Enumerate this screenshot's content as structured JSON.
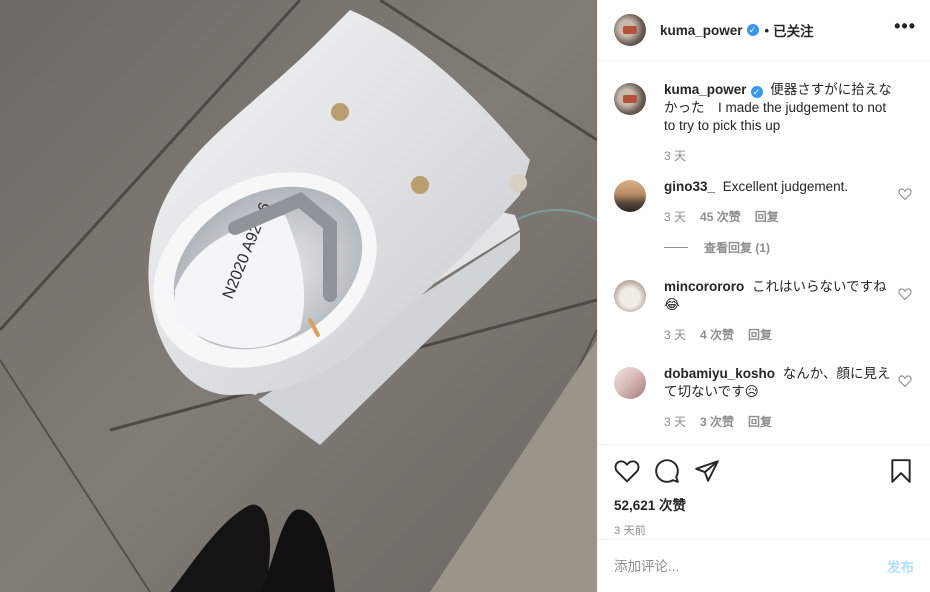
{
  "photo": {
    "description_icon": "photo",
    "bowl_writing": "N2020 A92-16"
  },
  "header": {
    "username": "kuma_power",
    "verified_icon": "verified-badge-icon",
    "separator": "•",
    "follow_state": "已关注",
    "more_label": "•••"
  },
  "caption": {
    "username": "kuma_power",
    "text": "便器さすがに拾えなかった　I made the judgement to not to try to pick this up",
    "time": "3 天"
  },
  "comments": [
    {
      "username": "gino33_",
      "text": "Excellent judgement.",
      "time": "3 天",
      "likes": "45 次赞",
      "reply": "回复",
      "view_replies": "查看回复 (1)"
    },
    {
      "username": "mincorororo",
      "text": "これはいらないですね😂",
      "time": "3 天",
      "likes": "4 次赞",
      "reply": "回复"
    },
    {
      "username": "dobamiyu_kosho",
      "text": "なんか、顔に見えて切ないです😥",
      "time": "3 天",
      "likes": "3 次赞",
      "reply": "回复"
    }
  ],
  "actions": {
    "likes_count": "52,621 次赞",
    "posted": "3 天前"
  },
  "add_comment": {
    "placeholder": "添加评论...",
    "post_label": "发布"
  },
  "colors": {
    "verified": "#3897f0",
    "muted_text": "#8e8e8e",
    "post_button_disabled": "#b2dffc",
    "border": "#efefef"
  }
}
